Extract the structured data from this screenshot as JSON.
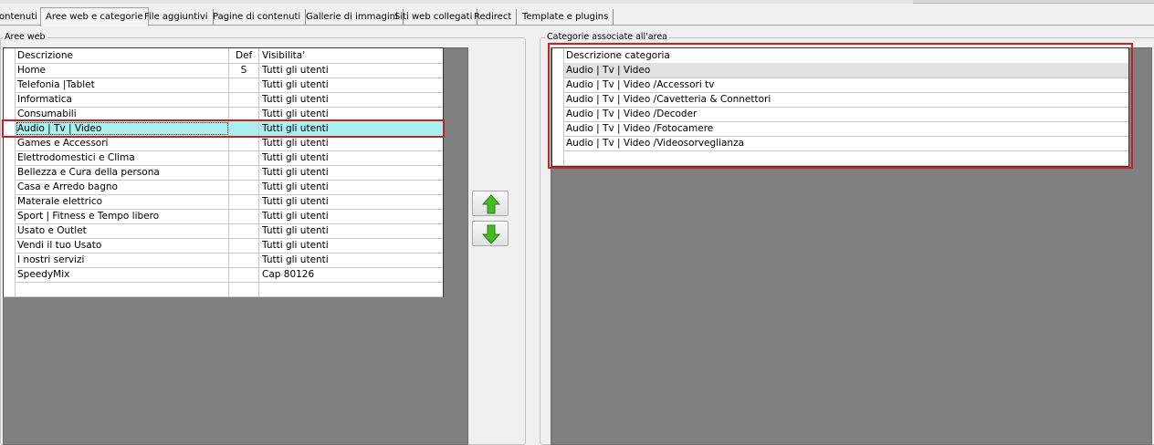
{
  "tabs": [
    {
      "label": "ontenuti",
      "active": false
    },
    {
      "label": "Aree web e categorie",
      "active": true
    },
    {
      "label": "File aggiuntivi",
      "active": false
    },
    {
      "label": "Pagine di contenuti",
      "active": false
    },
    {
      "label": "Gallerie di immagini",
      "active": false
    },
    {
      "label": "Siti web collegati",
      "active": false
    },
    {
      "label": "Redirect",
      "active": false
    },
    {
      "label": "Template e plugins",
      "active": false
    }
  ],
  "aree_web": {
    "group_label": "Aree web",
    "columns": [
      "Descrizione",
      "Def",
      "Visibilita'"
    ],
    "selected_index": 4,
    "rows": [
      {
        "descrizione": "Home",
        "def": "S",
        "visibilita": "Tutti gli utenti"
      },
      {
        "descrizione": "Telefonia |Tablet",
        "def": "",
        "visibilita": "Tutti gli utenti"
      },
      {
        "descrizione": "Informatica",
        "def": "",
        "visibilita": "Tutti gli utenti"
      },
      {
        "descrizione": "Consumabili",
        "def": "",
        "visibilita": "Tutti gli utenti"
      },
      {
        "descrizione": "Audio | Tv | Video",
        "def": "",
        "visibilita": "Tutti gli utenti"
      },
      {
        "descrizione": "Games e Accessori",
        "def": "",
        "visibilita": "Tutti gli utenti"
      },
      {
        "descrizione": "Elettrodomestici e Clima",
        "def": "",
        "visibilita": "Tutti gli utenti"
      },
      {
        "descrizione": "Bellezza e Cura della persona",
        "def": "",
        "visibilita": "Tutti gli utenti"
      },
      {
        "descrizione": "Casa e Arredo bagno",
        "def": "",
        "visibilita": "Tutti gli utenti"
      },
      {
        "descrizione": "Materale elettrico",
        "def": "",
        "visibilita": "Tutti gli utenti"
      },
      {
        "descrizione": "Sport | Fitness e Tempo libero",
        "def": "",
        "visibilita": "Tutti gli utenti"
      },
      {
        "descrizione": "Usato e Outlet",
        "def": "",
        "visibilita": "Tutti gli utenti"
      },
      {
        "descrizione": "Vendi il tuo Usato",
        "def": "",
        "visibilita": "Tutti gli utenti"
      },
      {
        "descrizione": "I nostri servizi",
        "def": "",
        "visibilita": "Tutti gli utenti"
      },
      {
        "descrizione": "SpeedyMix",
        "def": "",
        "visibilita": "Cap 80126"
      }
    ]
  },
  "categorie": {
    "group_label": "Categorie associate all'area",
    "column": "Descrizione categoria",
    "highlighted_index": 0,
    "rows": [
      "Audio | Tv | Video",
      "Audio | Tv | Video /Accessori tv",
      "Audio | Tv | Video /Cavetteria & Connettori",
      "Audio | Tv | Video /Decoder",
      "Audio | Tv | Video /Fotocamere",
      "Audio | Tv | Video /Videosorveglianza"
    ]
  },
  "buttons": {
    "move_up_icon": "green-arrow-up-icon",
    "move_down_icon": "green-arrow-down-icon"
  },
  "colors": {
    "selection": "#a9f1f1",
    "annotation_red": "#cc1f1f",
    "arrow_green": "#44bb22"
  }
}
